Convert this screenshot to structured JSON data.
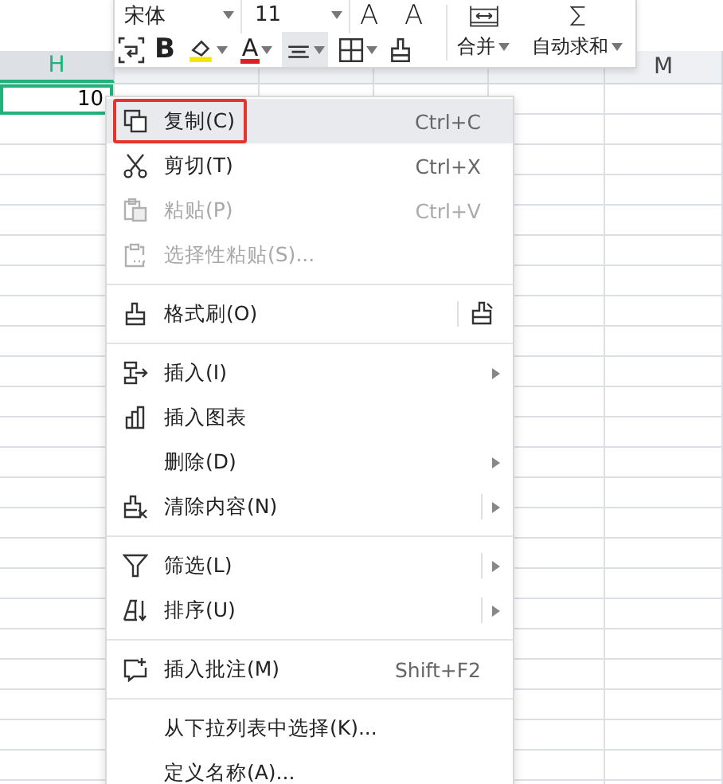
{
  "toolbar": {
    "font_name": "宋体",
    "font_size": "11",
    "grow_font": "A",
    "shrink_font": "A",
    "bold": "B",
    "font_color": "A",
    "align_selected": true,
    "merge_label": "合并",
    "autosum_label": "自动求和"
  },
  "sheet": {
    "columns": [
      {
        "label": "H",
        "selected": true
      },
      {
        "selected": false
      },
      {
        "selected": false
      },
      {
        "selected": false
      },
      {
        "selected": false
      },
      {
        "label": "M",
        "selected": false
      }
    ],
    "active_cell": {
      "value": "10"
    }
  },
  "context_menu": {
    "items": [
      {
        "kind": "item",
        "label": "复制(C)",
        "shortcut": "Ctrl+C",
        "selected": true,
        "disabled": false,
        "submenu": false,
        "split": false
      },
      {
        "kind": "item",
        "label": "剪切(T)",
        "shortcut": "Ctrl+X",
        "selected": false,
        "disabled": false,
        "submenu": false,
        "split": false
      },
      {
        "kind": "item",
        "label": "粘贴(P)",
        "shortcut": "Ctrl+V",
        "selected": false,
        "disabled": true,
        "submenu": false,
        "split": false
      },
      {
        "kind": "item",
        "label": "选择性粘贴(S)...",
        "selected": false,
        "disabled": true,
        "submenu": false,
        "split": false
      },
      {
        "kind": "separator"
      },
      {
        "kind": "item",
        "label": "格式刷(O)",
        "selected": false,
        "disabled": false,
        "submenu": false,
        "split": true
      },
      {
        "kind": "separator"
      },
      {
        "kind": "item",
        "label": "插入(I)",
        "selected": false,
        "disabled": false,
        "submenu": true,
        "split": false
      },
      {
        "kind": "item",
        "label": "插入图表",
        "selected": false,
        "disabled": false,
        "submenu": false,
        "split": false
      },
      {
        "kind": "item",
        "label": "删除(D)",
        "selected": false,
        "disabled": false,
        "submenu": true,
        "split": false
      },
      {
        "kind": "item",
        "label": "清除内容(N)",
        "selected": false,
        "disabled": false,
        "submenu": true,
        "split": true
      },
      {
        "kind": "separator"
      },
      {
        "kind": "item",
        "label": "筛选(L)",
        "selected": false,
        "disabled": false,
        "submenu": true,
        "split": true
      },
      {
        "kind": "item",
        "label": "排序(U)",
        "selected": false,
        "disabled": false,
        "submenu": true,
        "split": true
      },
      {
        "kind": "separator"
      },
      {
        "kind": "item",
        "label": "插入批注(M)",
        "shortcut": "Shift+F2",
        "selected": false,
        "disabled": false,
        "submenu": false,
        "split": false
      },
      {
        "kind": "separator"
      },
      {
        "kind": "item",
        "label": "从下拉列表中选择(K)...",
        "selected": false,
        "disabled": false,
        "submenu": false,
        "split": false
      },
      {
        "kind": "item",
        "label": "定义名称(A)...",
        "selected": false,
        "disabled": false,
        "submenu": false,
        "split": false
      }
    ]
  }
}
